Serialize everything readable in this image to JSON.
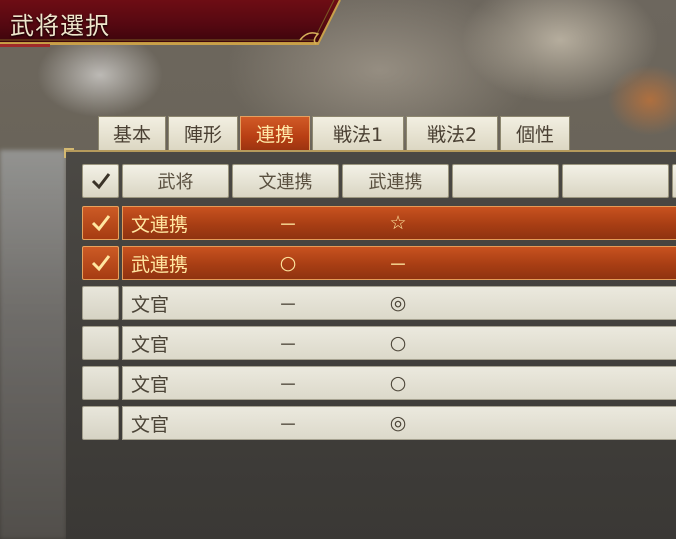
{
  "title": "武将選択",
  "tabs": [
    {
      "label": "基本",
      "active": false
    },
    {
      "label": "陣形",
      "active": false
    },
    {
      "label": "連携",
      "active": true
    },
    {
      "label": "戦法1",
      "active": false
    },
    {
      "label": "戦法2",
      "active": false
    },
    {
      "label": "個性",
      "active": false
    }
  ],
  "header": {
    "col_name": "武将",
    "col_a": "文連携",
    "col_b": "武連携",
    "col_c": "",
    "col_d": ""
  },
  "rows": [
    {
      "name": "文連携",
      "a": "－",
      "b": "☆",
      "selected": true
    },
    {
      "name": "武連携",
      "a": "○",
      "b": "－",
      "selected": true
    },
    {
      "name": "文官",
      "a": "－",
      "b": "◎",
      "selected": false
    },
    {
      "name": "文官",
      "a": "－",
      "b": "○",
      "selected": false
    },
    {
      "name": "文官",
      "a": "－",
      "b": "○",
      "selected": false
    },
    {
      "name": "文官",
      "a": "－",
      "b": "◎",
      "selected": false
    }
  ],
  "colors": {
    "accent": "#c8521f",
    "title_bg": "#5a0a12",
    "highlight_text": "#ffe6a0"
  }
}
